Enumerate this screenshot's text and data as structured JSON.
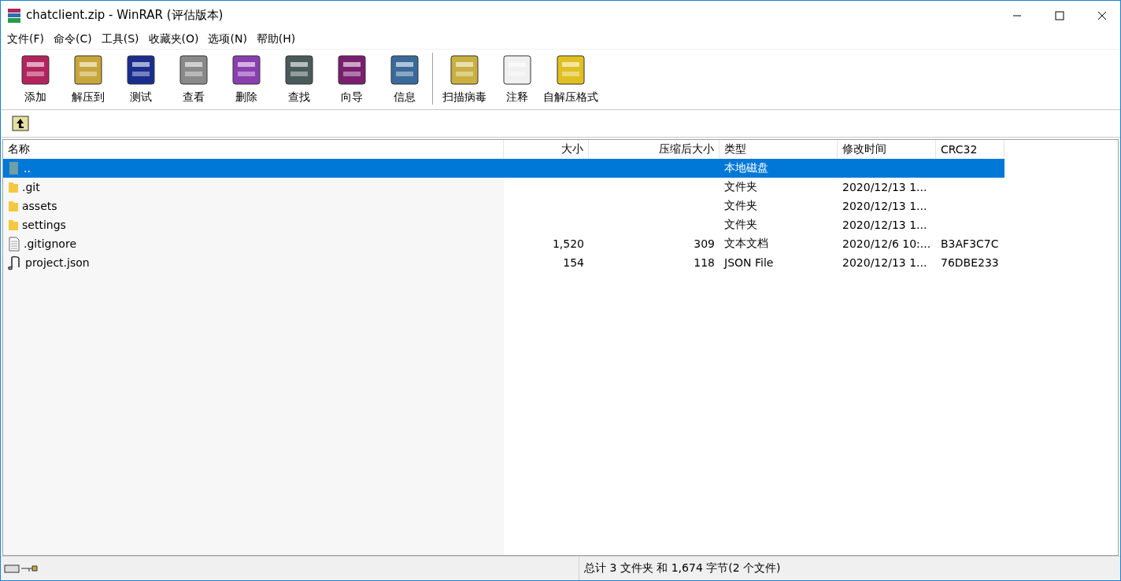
{
  "window": {
    "title": "chatclient.zip - WinRAR (评估版本)"
  },
  "menu": [
    "文件(F)",
    "命令(C)",
    "工具(S)",
    "收藏夹(O)",
    "选项(N)",
    "帮助(H)"
  ],
  "toolbar": [
    {
      "kind": "add",
      "label": "添加"
    },
    {
      "kind": "extract",
      "label": "解压到"
    },
    {
      "kind": "test",
      "label": "测试"
    },
    {
      "kind": "view",
      "label": "查看"
    },
    {
      "kind": "delete",
      "label": "删除"
    },
    {
      "kind": "find",
      "label": "查找"
    },
    {
      "kind": "wizard",
      "label": "向导"
    },
    {
      "kind": "info",
      "label": "信息"
    },
    {
      "kind": "separator"
    },
    {
      "kind": "virus",
      "label": "扫描病毒"
    },
    {
      "kind": "comment",
      "label": "注释"
    },
    {
      "kind": "sfx",
      "label": "自解压格式"
    }
  ],
  "table": {
    "columns": [
      "名称",
      "大小",
      "压缩后大小",
      "类型",
      "修改时间",
      "CRC32"
    ],
    "rows": [
      {
        "kind": "parent",
        "selected": true,
        "name": "..",
        "type": "本地磁盘"
      },
      {
        "kind": "folder",
        "selected": false,
        "name": ".git",
        "type": "文件夹",
        "modified": "2020/12/13 1..."
      },
      {
        "kind": "folder",
        "selected": false,
        "name": "assets",
        "type": "文件夹",
        "modified": "2020/12/13 1..."
      },
      {
        "kind": "folder",
        "selected": false,
        "name": "settings",
        "type": "文件夹",
        "modified": "2020/12/13 1..."
      },
      {
        "kind": "text",
        "selected": false,
        "name": ".gitignore",
        "size": "1,520",
        "packed": "309",
        "type": "文本文档",
        "modified": "2020/12/6 10:...",
        "crc": "B3AF3C7C"
      },
      {
        "kind": "json",
        "selected": false,
        "name": "project.json",
        "size": "154",
        "packed": "118",
        "type": "JSON File",
        "modified": "2020/12/13 1...",
        "crc": "76DBE233"
      }
    ]
  },
  "status_bar": {
    "text": "总计 3 文件夹 和 1,674 字节(2 个文件)"
  }
}
